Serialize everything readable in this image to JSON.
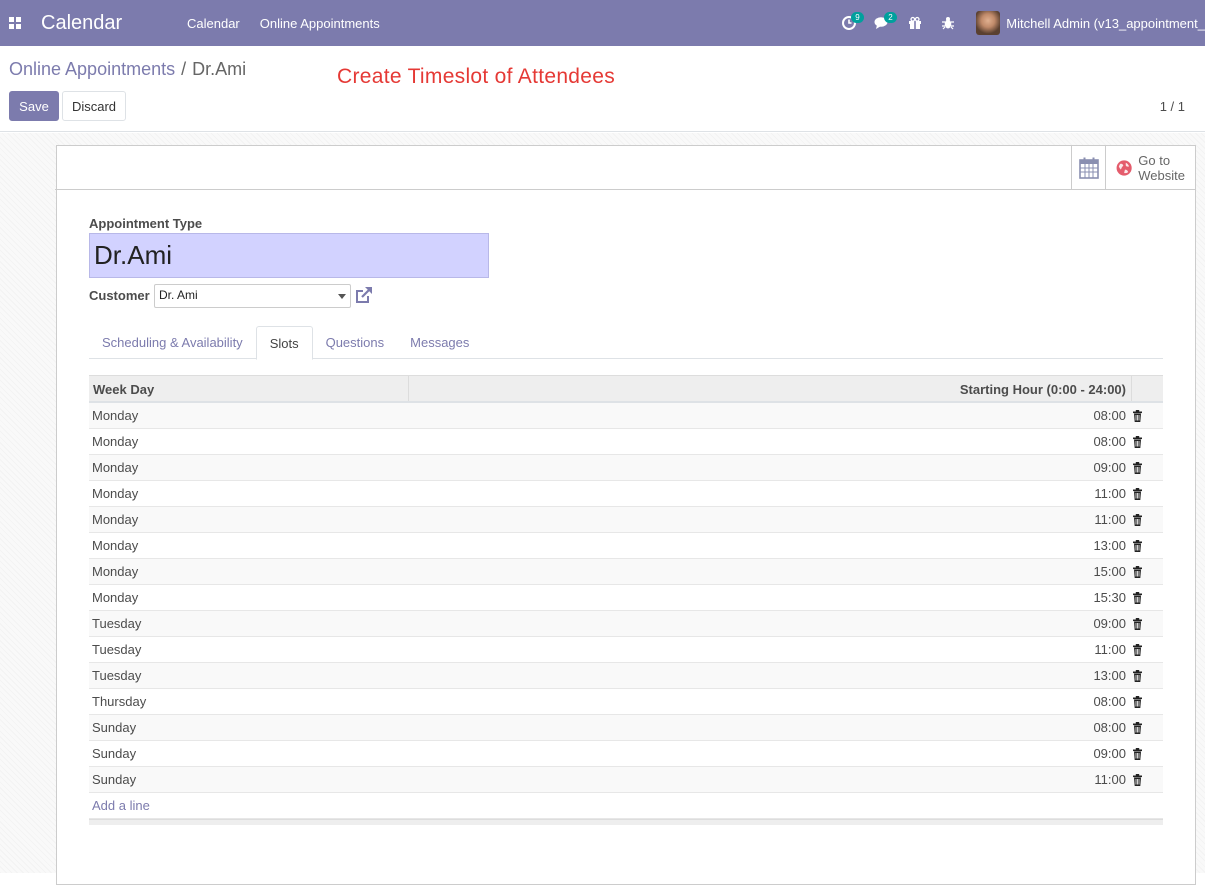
{
  "navbar": {
    "brand": "Calendar",
    "menu": [
      "Calendar",
      "Online Appointments"
    ],
    "activity_count": "9",
    "messages_count": "2",
    "user": "Mitchell Admin (v13_appointment_"
  },
  "control_panel": {
    "breadcrumb_parent": "Online Appointments",
    "breadcrumb_sep": "/",
    "breadcrumb_current": "Dr.Ami",
    "annotation": "Create Timeslot of Attendees",
    "save_label": "Save",
    "discard_label": "Discard",
    "pager": "1 / 1"
  },
  "button_box": {
    "website_line1": "Go to",
    "website_line2": "Website"
  },
  "form": {
    "type_label": "Appointment Type",
    "name": "Dr.Ami",
    "customer_label": "Customer",
    "customer_value": "Dr. Ami"
  },
  "tabs": [
    "Scheduling & Availability",
    "Slots",
    "Questions",
    "Messages"
  ],
  "active_tab": "Slots",
  "slots": {
    "headers": [
      "Week Day",
      "Starting Hour (0:00 - 24:00)"
    ],
    "rows": [
      {
        "day": "Monday",
        "hour": "08:00"
      },
      {
        "day": "Monday",
        "hour": "08:00"
      },
      {
        "day": "Monday",
        "hour": "09:00"
      },
      {
        "day": "Monday",
        "hour": "11:00"
      },
      {
        "day": "Monday",
        "hour": "11:00"
      },
      {
        "day": "Monday",
        "hour": "13:00"
      },
      {
        "day": "Monday",
        "hour": "15:00"
      },
      {
        "day": "Monday",
        "hour": "15:30"
      },
      {
        "day": "Tuesday",
        "hour": "09:00"
      },
      {
        "day": "Tuesday",
        "hour": "11:00"
      },
      {
        "day": "Tuesday",
        "hour": "13:00"
      },
      {
        "day": "Thursday",
        "hour": "08:00"
      },
      {
        "day": "Sunday",
        "hour": "08:00"
      },
      {
        "day": "Sunday",
        "hour": "09:00"
      },
      {
        "day": "Sunday",
        "hour": "11:00"
      }
    ],
    "add_line": "Add a line"
  },
  "colors": {
    "brand": "#7c7bad",
    "annotation": "#e53935",
    "badge": "#00a09d",
    "name_field": "#d2d2ff"
  }
}
